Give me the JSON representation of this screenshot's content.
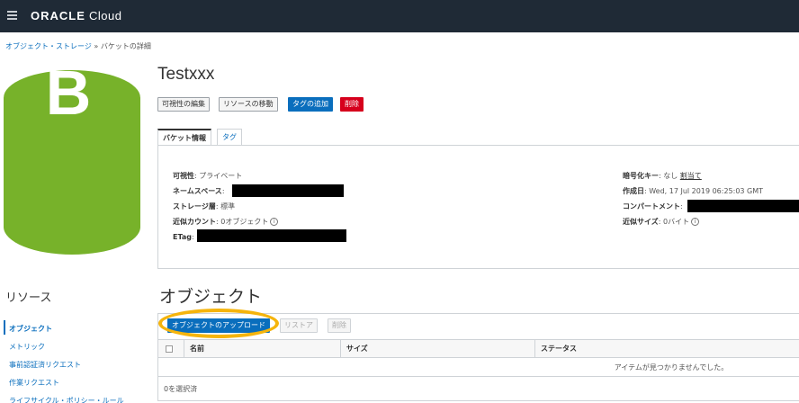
{
  "header": {
    "brand_bold": "ORACLE",
    "brand_rest": " Cloud"
  },
  "breadcrumb": {
    "parent": "オブジェクト・ストレージ",
    "separator": " » ",
    "current": "バケットの詳細"
  },
  "badge": {
    "letter": "B",
    "color": "#77b22a"
  },
  "bucket": {
    "name": "Testxxx"
  },
  "actions": {
    "edit_visibility": "可視性の編集",
    "move_resource": "リソースの移動",
    "add_tags": "タグの追加",
    "delete": "削除"
  },
  "tabs": [
    {
      "label": "バケット情報"
    },
    {
      "label": "タグ"
    }
  ],
  "info": {
    "visibility_label": "可視性",
    "visibility_value": ": プライベート",
    "namespace_label": "ネームスペース",
    "namespace_value": ":",
    "storage_tier_label": "ストレージ層",
    "storage_tier_value": ": 標準",
    "approx_count_label": "近似カウント",
    "approx_count_value": ": 0オブジェクト",
    "etag_label": "ETag",
    "etag_value": ":",
    "encryption_label": "暗号化キー",
    "encryption_value": ": なし",
    "encryption_link": "割当て",
    "created_label": "作成日",
    "created_value": ": Wed, 17 Jul 2019 06:25:03 GMT",
    "compartment_label": "コンパートメント",
    "compartment_value": ":",
    "approx_size_label": "近似サイズ",
    "approx_size_value": ": 0バイト",
    "info_icon": "i"
  },
  "resources": {
    "title": "リソース",
    "items": [
      {
        "label": "オブジェクト"
      },
      {
        "label": "メトリック"
      },
      {
        "label": "事前認証済リクエスト"
      },
      {
        "label": "作業リクエスト"
      },
      {
        "label": "ライフサイクル・ポリシー・ルール"
      }
    ]
  },
  "objects": {
    "title": "オブジェクト",
    "upload_button": "オブジェクトのアップロード",
    "restore_button": "リストア",
    "delete_button": "削除",
    "columns": [
      "名前",
      "サイズ",
      "ステータス"
    ],
    "empty_message": "アイテムが見つかりませんでした。",
    "selected_count": "0を選択済"
  },
  "colors": {
    "accent": "#0a6ebd",
    "danger": "#d6001c",
    "highlight": "#f5b40c",
    "topbar": "#1f2a36"
  }
}
